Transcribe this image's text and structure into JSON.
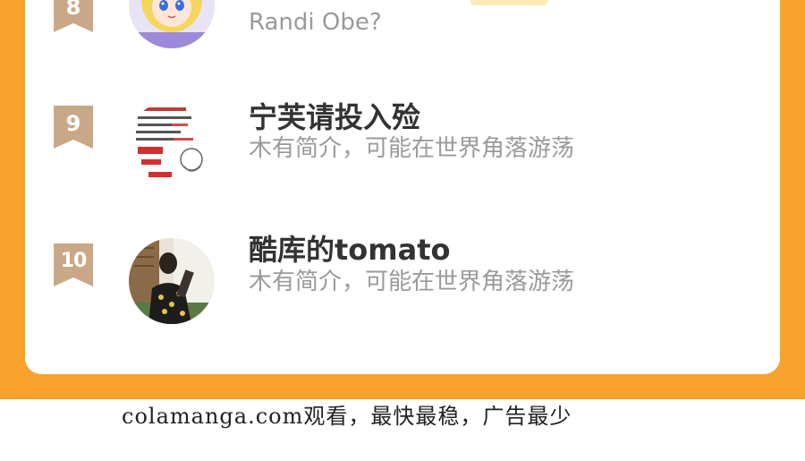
{
  "ranking": {
    "items": [
      {
        "rank": "8",
        "name": "",
        "description": "Randi Obe?",
        "avatar": "anime-girl-avatar"
      },
      {
        "rank": "9",
        "name": "宁芙请投入殓",
        "description": "木有简介，可能在世界角落游荡",
        "avatar": "meme-text-avatar"
      },
      {
        "rank": "10",
        "name": "酷库的tomato",
        "description": "木有简介，可能在世界角落游荡",
        "avatar": "person-photo-avatar"
      }
    ]
  },
  "footer": {
    "text": "colamanga.com观看，最快最稳，广告最少"
  },
  "colors": {
    "frame": "#f7a32d",
    "badge": "#c9a888",
    "name": "#333333",
    "description": "#9a9a9a"
  }
}
